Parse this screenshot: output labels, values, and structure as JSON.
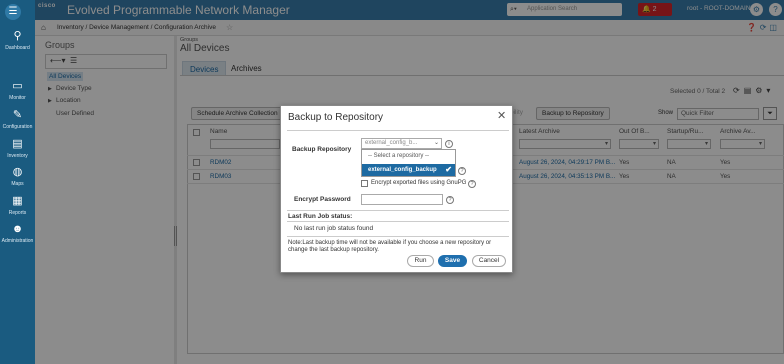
{
  "header": {
    "brand": "cisco",
    "app_title": "Evolved Programmable Network Manager",
    "search_placeholder": "Application Search",
    "alarm_count": "2",
    "user": "root - ROOT-DOMAIN"
  },
  "nav": {
    "items": [
      {
        "label": "Dashboard",
        "icon": "dashboard-icon"
      },
      {
        "label": "Monitor",
        "icon": "monitor-icon"
      },
      {
        "label": "Configuration",
        "icon": "configuration-icon"
      },
      {
        "label": "Inventory",
        "icon": "inventory-icon"
      },
      {
        "label": "Maps",
        "icon": "maps-icon"
      },
      {
        "label": "Reports",
        "icon": "reports-icon"
      },
      {
        "label": "Administration",
        "icon": "administration-icon"
      }
    ]
  },
  "breadcrumb": "Inventory / Device Management / Configuration Archive",
  "groups": {
    "title": "Groups",
    "items": [
      "All Devices",
      "Device Type",
      "Location",
      "User Defined"
    ]
  },
  "main": {
    "groups_label": "Groups",
    "title": "All Devices",
    "tabs": [
      "Devices",
      "Archives"
    ],
    "selected_total": "Selected 0 / Total 2",
    "buttons": {
      "schedule": "Schedule Archive Collection",
      "bility": "bility",
      "backup": "Backup to Repository"
    },
    "show_label": "Show",
    "quick_filter": "Quick Filter",
    "columns": [
      "Name",
      "Latest Archive",
      "Out Of B...",
      "Startup/Ru...",
      "Archive Av..."
    ],
    "rows": [
      {
        "name": "RDM02",
        "latest": "August 26, 2024, 04:29:17 PM B...",
        "oob": "Yes",
        "startup": "NA",
        "archive": "Yes"
      },
      {
        "name": "RDM03",
        "latest": "August 26, 2024, 04:35:13 PM B...",
        "oob": "Yes",
        "startup": "NA",
        "archive": "Yes"
      }
    ]
  },
  "dialog": {
    "title": "Backup to Repository",
    "repo_label": "Backup Repository",
    "repo_value": "external_config_b...",
    "options": [
      "-- Select a repository --",
      "external_config_backup"
    ],
    "gpg_label": "Encrypt exported files using GnuPG",
    "password_label": "Encrypt Password",
    "status_title": "Last Run Job status:",
    "status_value": "No last run job status found",
    "note": "Note:Last backup time will not be available if you choose a new repository or change the last backup repository.",
    "buttons": {
      "run": "Run",
      "save": "Save",
      "cancel": "Cancel"
    }
  },
  "colors": {
    "nav_bg": "#1a5b80",
    "header_bg": "#3a7fae",
    "primary": "#1f6fae",
    "alarm": "#d9262b"
  }
}
